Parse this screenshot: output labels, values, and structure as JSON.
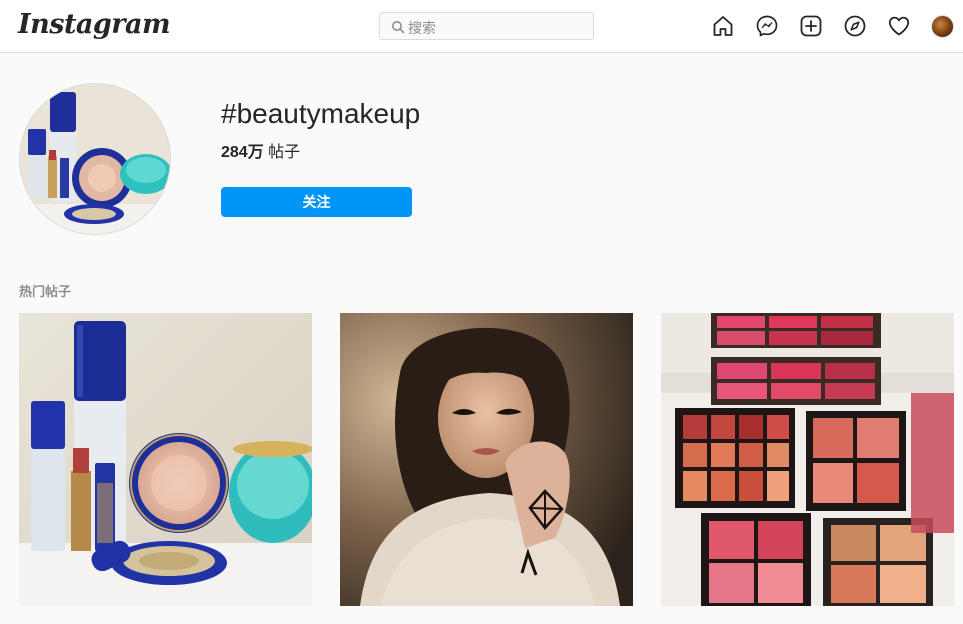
{
  "header": {
    "logo_text": "Instagram",
    "search_placeholder": "搜索",
    "nav_icons": [
      "home-icon",
      "messenger-icon",
      "new-post-icon",
      "explore-icon",
      "activity-heart-icon",
      "profile-avatar"
    ]
  },
  "hashtag": {
    "title": "#beautymakeup",
    "post_count": "284万",
    "post_count_suffix": "帖子",
    "follow_label": "关注"
  },
  "top_posts": {
    "label": "热门帖子",
    "posts": [
      "post-makeup-products",
      "post-portrait",
      "post-eyeshadow-palettes"
    ]
  },
  "colors": {
    "accent": "#0095f6",
    "border": "#dbdbdb",
    "background": "#fafafa",
    "muted": "#8e8e8e"
  }
}
